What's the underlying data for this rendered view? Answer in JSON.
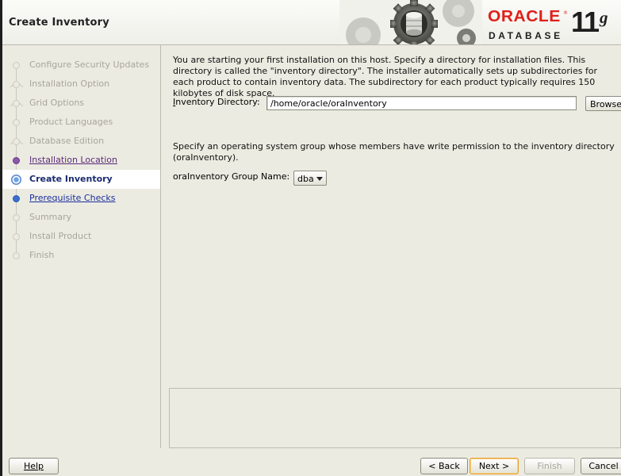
{
  "header": {
    "title": "Create Inventory",
    "logo_brand": "ORACLE",
    "logo_registered": "®",
    "logo_product": "DATABASE",
    "logo_version": "11",
    "logo_version_suffix": "g"
  },
  "steps": [
    {
      "label": "Configure Security Updates",
      "state": "done"
    },
    {
      "label": "Installation Option",
      "state": "done"
    },
    {
      "label": "Grid Options",
      "state": "done"
    },
    {
      "label": "Product Languages",
      "state": "done"
    },
    {
      "label": "Database Edition",
      "state": "done"
    },
    {
      "label": "Installation Location",
      "state": "visited"
    },
    {
      "label": "Create Inventory",
      "state": "current"
    },
    {
      "label": "Prerequisite Checks",
      "state": "link"
    },
    {
      "label": "Summary",
      "state": "future"
    },
    {
      "label": "Install Product",
      "state": "future"
    },
    {
      "label": "Finish",
      "state": "future"
    }
  ],
  "content": {
    "intro": "You are starting your first installation on this host. Specify a directory for installation files. This directory is called the \"inventory directory\". The installer automatically sets up subdirectories for each product to contain inventory data. The subdirectory for each product typically requires 150 kilobytes of disk space.",
    "inventory_label": "Inventory Directory:",
    "inventory_value": "/home/oracle/oraInventory",
    "browse_label": "Browse...",
    "group_desc": "Specify an operating system group whose members have write permission to the inventory directory (oraInventory).",
    "group_label": "oraInventory Group Name:",
    "group_value": "dba"
  },
  "buttons": {
    "help": "Help",
    "back": "< Back",
    "next": "Next >",
    "finish": "Finish",
    "cancel": "Cancel"
  },
  "colors": {
    "oracle_red": "#e0201b",
    "window_bg": "#ecebe1",
    "current_step_text": "#1a2c6e"
  }
}
